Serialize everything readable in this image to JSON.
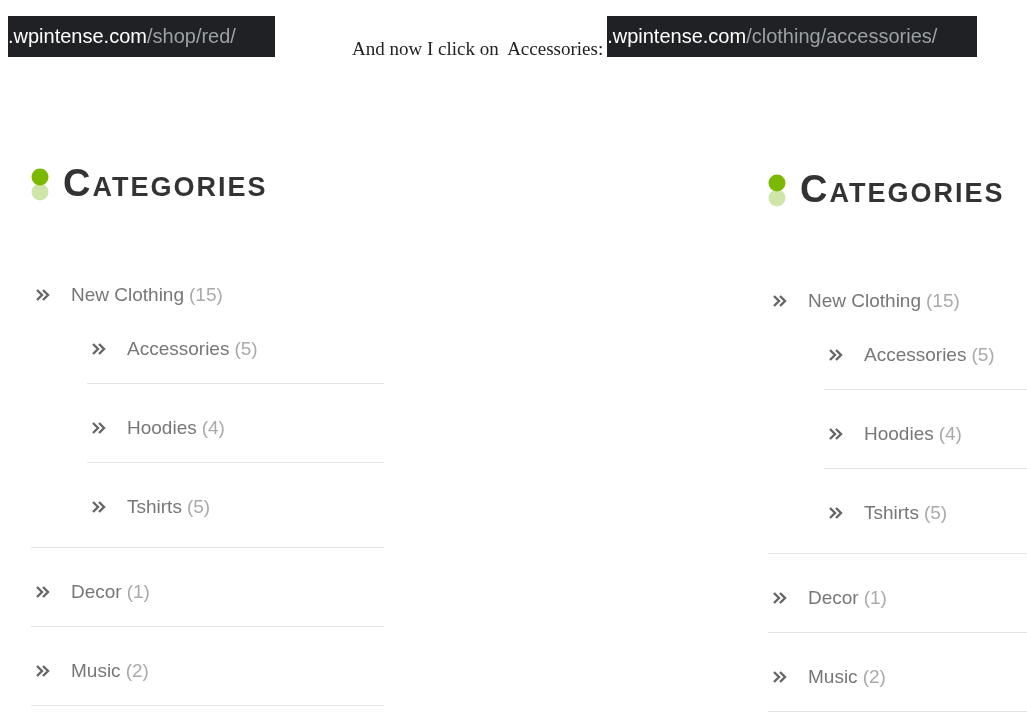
{
  "top": [
    {
      "kind": "address",
      "domain": ".wpintense.com",
      "path": "/shop/red/"
    },
    {
      "kind": "caption",
      "text": "And now I click on  Accessories:"
    },
    {
      "kind": "address",
      "domain": ".wpintense.com",
      "path": "/clothing/accessories/"
    }
  ],
  "widgets": [
    {
      "title": "CATEGORIES",
      "items": [
        {
          "name": "New Clothing",
          "count": "(15)",
          "children": [
            {
              "name": "Accessories",
              "count": "(5)"
            },
            {
              "name": "Hoodies",
              "count": "(4)"
            },
            {
              "name": "Tshirts",
              "count": "(5)"
            }
          ]
        },
        {
          "name": "Decor",
          "count": "(1)"
        },
        {
          "name": "Music",
          "count": "(2)"
        }
      ]
    },
    {
      "title": "CATEGORIES",
      "items": [
        {
          "name": "New Clothing",
          "count": "(15)",
          "children": [
            {
              "name": "Accessories",
              "count": "(5)"
            },
            {
              "name": "Hoodies",
              "count": "(4)"
            },
            {
              "name": "Tshirts",
              "count": "(5)"
            }
          ]
        },
        {
          "name": "Decor",
          "count": "(1)"
        },
        {
          "name": "Music",
          "count": "(2)"
        }
      ]
    }
  ]
}
